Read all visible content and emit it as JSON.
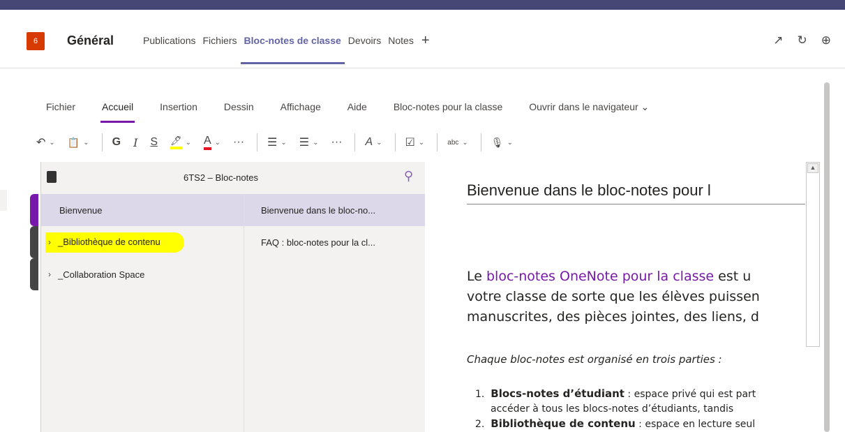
{
  "header": {
    "team_avatar_text": "6",
    "channel_name": "Général",
    "tabs": [
      {
        "label": "Publications"
      },
      {
        "label": "Fichiers"
      },
      {
        "label": "Bloc-notes de classe"
      },
      {
        "label": "Devoirs"
      },
      {
        "label": "Notes"
      }
    ],
    "active_tab": "Bloc-notes de classe",
    "add_tab_symbol": "+",
    "icons": {
      "expand": "↗",
      "reload": "↻",
      "globe": "⊕"
    }
  },
  "ribbon": {
    "menu": [
      {
        "label": "Fichier"
      },
      {
        "label": "Accueil"
      },
      {
        "label": "Insertion"
      },
      {
        "label": "Dessin"
      },
      {
        "label": "Affichage"
      },
      {
        "label": "Aide"
      },
      {
        "label": "Bloc-notes pour la classe"
      },
      {
        "label": "Ouvrir dans le navigateur"
      }
    ],
    "active_menu": "Accueil",
    "toolbar": {
      "undo": "↶",
      "clipboard": "📋",
      "bold": "G",
      "italic": "I",
      "strikethrough": "S",
      "highlight": "🖊",
      "font_color": "A",
      "more": "···",
      "bullets": "☰",
      "numbering": "☰",
      "more2": "···",
      "styles": "A",
      "tag": "☑",
      "spelling": "abc",
      "dictate": "🎙",
      "highlight_color": "#ffff00",
      "font_color_value": "#e81123"
    }
  },
  "notebook": {
    "title": "6TS2 – Bloc-notes",
    "sections": [
      {
        "label": "Bienvenue",
        "selected": true,
        "expandable": false,
        "color": "#7719aa"
      },
      {
        "label": "_Bibliothèque de contenu",
        "selected": false,
        "expandable": true,
        "highlighted": true,
        "color": "#444"
      },
      {
        "label": "_Collaboration Space",
        "selected": false,
        "expandable": true,
        "color": "#444"
      }
    ],
    "pages": [
      {
        "label": "Bienvenue dans le bloc-no...",
        "selected": true
      },
      {
        "label": "FAQ : bloc-notes pour la cl...",
        "selected": false
      }
    ]
  },
  "page": {
    "title": "Bienvenue dans le bloc-notes pour l",
    "para_line1_prefix": "Le ",
    "para_line1_link": "bloc-notes OneNote pour la classe",
    "para_line1_suffix": " est u",
    "para_line2": "votre classe de sorte que les élèves puissen",
    "para_line3": "manuscrites, des pièces jointes, des liens, d",
    "italic": "Chaque bloc-notes est organisé en trois parties :",
    "list": [
      {
        "num": "1.",
        "bold": "Blocs-notes d’étudiant",
        "text": " : espace privé qui est part",
        "cont": "accéder à tous les blocs-notes d’étudiants, tandis"
      },
      {
        "num": "2.",
        "bold": "Bibliothèque de contenu",
        "text": " : espace en lecture seul"
      }
    ]
  }
}
